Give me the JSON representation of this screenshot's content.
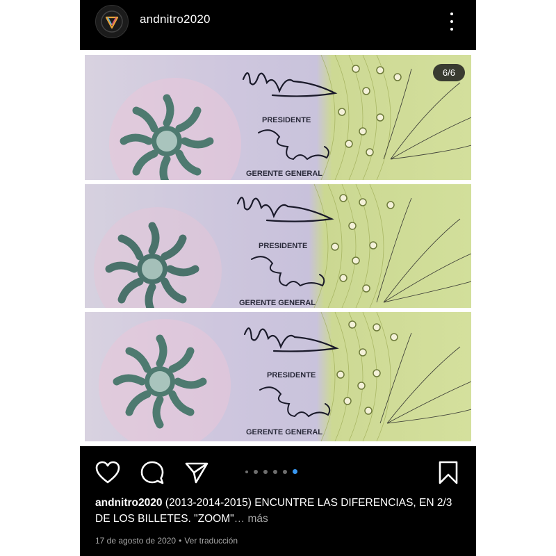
{
  "header": {
    "username": "andnitro2020",
    "avatar_icon": "triangle-logo-icon",
    "more_icon": "more-vertical-icon"
  },
  "media": {
    "counter": "6/6",
    "notes": [
      {
        "label_top": "PRESIDENTE",
        "label_bottom": "GERENTE GENERAL"
      },
      {
        "label_top": "PRESIDENTE",
        "label_bottom": "GERENTE GENERAL"
      },
      {
        "label_top": "PRESIDENTE",
        "label_bottom": "GERENTE GENERAL"
      }
    ]
  },
  "actions": {
    "like_icon": "heart-icon",
    "comment_icon": "comment-icon",
    "share_icon": "send-icon",
    "save_icon": "bookmark-icon",
    "carousel_total": 6,
    "carousel_active": 6
  },
  "caption": {
    "user": "andnitro2020",
    "text": " (2013-2014-2015) ENCUNTRE LAS DIFERENCIAS, EN 2/3 DE LOS BILLETES. \"ZOOM\"",
    "more": "… más"
  },
  "meta": {
    "date": "17 de agosto de 2020",
    "separator": "•",
    "translate": "Ver traducción"
  },
  "colors": {
    "background": "#000000",
    "accent_blue": "#3897f0",
    "note_lilac": "#c9c3d9",
    "note_green": "#c9d88a",
    "ink": "#1a1a2a"
  }
}
